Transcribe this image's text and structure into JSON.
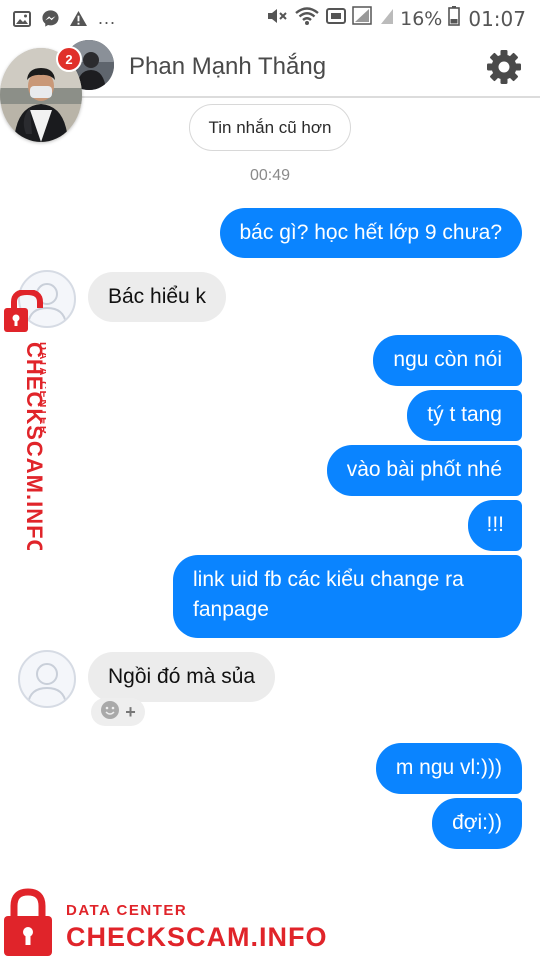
{
  "status_bar": {
    "battery_percent": "16%",
    "time": "01:07",
    "dots": "..."
  },
  "header": {
    "contact_name": "Phan Mạnh Thắng",
    "unread_badge": "2",
    "settings_icon": "gear-icon"
  },
  "chat": {
    "older_label": "Tin nhắn cũ hơn",
    "timestamp": "00:49",
    "messages": [
      {
        "from": "me",
        "text": "bác gì? học hết lớp 9 chưa?"
      },
      {
        "from": "them",
        "text": "Bác hiểu k"
      },
      {
        "from": "me",
        "text": "ngu còn nói"
      },
      {
        "from": "me",
        "text": "tý t tang"
      },
      {
        "from": "me",
        "text": "vào bài phốt nhé"
      },
      {
        "from": "me",
        "text": "!!!"
      },
      {
        "from": "me",
        "line1": "link uid fb các kiểu change ra",
        "line2": "fanpage"
      },
      {
        "from": "them",
        "text": "Ngồi đó mà sủa"
      },
      {
        "from": "me",
        "text": "m ngu vl:)))"
      },
      {
        "from": "me",
        "text": "đợi:))"
      }
    ]
  },
  "watermark": {
    "line1": "DATA CENTER",
    "line2": "CHECKSCAM.INFO"
  },
  "colors": {
    "outgoing_bubble": "#0a84ff",
    "incoming_bubble": "#ececec",
    "watermark_red": "#e0242a",
    "badge_red": "#e0302a"
  }
}
